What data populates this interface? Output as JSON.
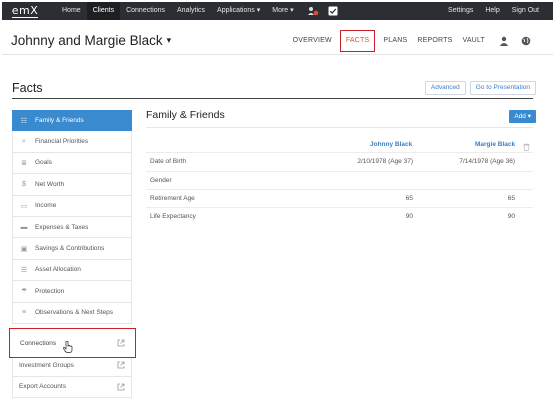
{
  "topnav": {
    "logo": "emX",
    "items": [
      "Home",
      "Clients",
      "Connections",
      "Analytics",
      "Applications ▾",
      "More ▾"
    ],
    "active_index": 1,
    "right_items": [
      "Settings",
      "Help",
      "Sign Out"
    ]
  },
  "client": {
    "name": "Johnny and Margie Black",
    "caret": "▾"
  },
  "subnav": {
    "tabs": [
      "OVERVIEW",
      "FACTS",
      "PLANS",
      "REPORTS",
      "VAULT"
    ],
    "active_index": 1
  },
  "facts": {
    "title": "Facts",
    "advanced_label": "Advanced",
    "presentation_label": "Go to Presentation"
  },
  "sidebar": {
    "items": [
      {
        "label": "Family & Friends",
        "icon": "people-icon",
        "glyph": "☷"
      },
      {
        "label": "Financial Priorities",
        "icon": "search-icon",
        "glyph": "⌕"
      },
      {
        "label": "Goals",
        "icon": "list-icon",
        "glyph": "≣"
      },
      {
        "label": "Net Worth",
        "icon": "dollar-icon",
        "glyph": "$"
      },
      {
        "label": "Income",
        "icon": "cash-icon",
        "glyph": "▭"
      },
      {
        "label": "Expenses & Taxes",
        "icon": "card-icon",
        "glyph": "▬"
      },
      {
        "label": "Savings & Contributions",
        "icon": "savings-icon",
        "glyph": "▣"
      },
      {
        "label": "Asset Allocation",
        "icon": "allocation-icon",
        "glyph": "☰"
      },
      {
        "label": "Protection",
        "icon": "umbrella-icon",
        "glyph": "☂"
      },
      {
        "label": "Observations & Next Steps",
        "icon": "notes-icon",
        "glyph": "≡"
      }
    ],
    "active_index": 0,
    "links": [
      {
        "label": "Connections"
      },
      {
        "label": "Investment Groups"
      },
      {
        "label": "Export Accounts"
      }
    ]
  },
  "main": {
    "title": "Family & Friends",
    "add_label": "Add ▾",
    "columns": [
      "Johnny Black",
      "Margie Black"
    ],
    "rows": [
      {
        "label": "Date of Birth",
        "v1": "2/10/1978 (Age 37)",
        "v2": "7/14/1978 (Age 36)"
      },
      {
        "label": "Gender",
        "v1": "",
        "v2": ""
      },
      {
        "label": "Retirement Age",
        "v1": "65",
        "v2": "65"
      },
      {
        "label": "Life Expectancy",
        "v1": "90",
        "v2": "90"
      }
    ]
  },
  "colors": {
    "nav_bg": "#2b2e33",
    "accent_blue": "#3a8ad0",
    "active_tab": "#e8521e",
    "highlight_red": "#c8202a"
  }
}
